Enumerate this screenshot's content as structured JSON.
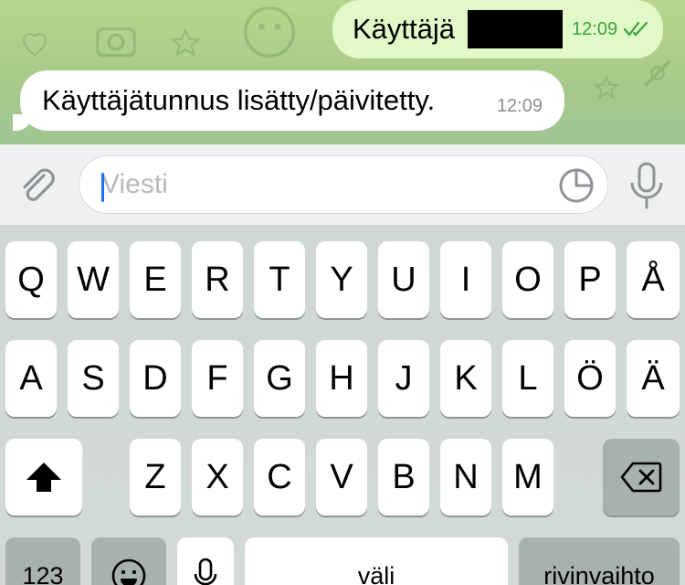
{
  "chat": {
    "outgoing": {
      "text": "Käyttäjä",
      "time": "12:09"
    },
    "incoming": {
      "text": "Käyttäjätunnus lisätty/päivitetty.",
      "time": "12:09"
    }
  },
  "input": {
    "placeholder": "Viesti"
  },
  "keyboard": {
    "row1": [
      "Q",
      "W",
      "E",
      "R",
      "T",
      "Y",
      "U",
      "I",
      "O",
      "P",
      "Å"
    ],
    "row2": [
      "A",
      "S",
      "D",
      "F",
      "G",
      "H",
      "J",
      "K",
      "L",
      "Ö",
      "Ä"
    ],
    "row3": [
      "Z",
      "X",
      "C",
      "V",
      "B",
      "N",
      "M"
    ],
    "numbers_label": "123",
    "space_label": "väli",
    "return_label": "rivinvaihto"
  },
  "colors": {
    "accent_blue": "#1d6cf5",
    "outgoing_bubble": "#e1f8c9",
    "read_ticks": "#3da33a"
  },
  "icons": {
    "attach": "paperclip-icon",
    "sticker": "sticker-icon",
    "voice": "microphone-icon",
    "shift": "shift-arrow-icon",
    "delete": "backspace-icon",
    "emoji": "emoji-icon",
    "dictation": "dictation-mic-icon"
  }
}
